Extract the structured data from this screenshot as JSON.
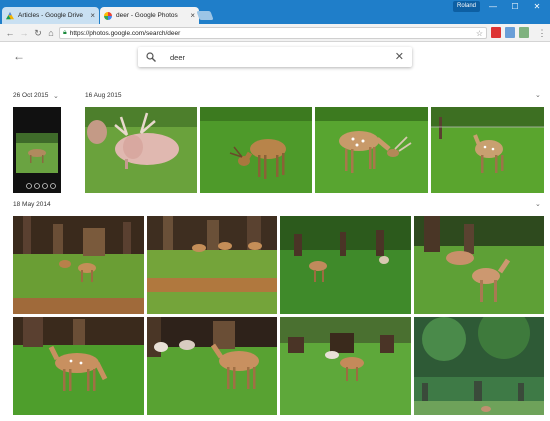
{
  "browser": {
    "tabs": [
      {
        "title": "Articles - Google Drive"
      },
      {
        "title": "deer - Google Photos"
      }
    ],
    "profile": "Roland",
    "url": "https://photos.google.com/search/deer"
  },
  "search": {
    "query": "deer"
  },
  "groups": [
    {
      "date": "26 Oct 2015"
    },
    {
      "date": "16 Aug 2015"
    },
    {
      "date": "18 May 2014"
    }
  ],
  "colors": {
    "chrome_blue": "#1f7ec9",
    "grass": "#4e9a2a",
    "tree_dark": "#3c2c1c"
  }
}
